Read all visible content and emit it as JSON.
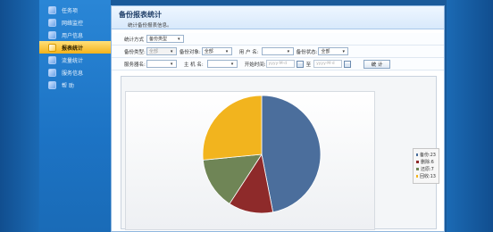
{
  "sidebar": {
    "items": [
      {
        "label": "任务项",
        "icon": "task-icon",
        "active": false
      },
      {
        "label": "网络监控",
        "icon": "network-monitor-icon",
        "active": false
      },
      {
        "label": "用户信息",
        "icon": "user-info-icon",
        "active": false
      },
      {
        "label": "报表统计",
        "icon": "report-icon",
        "active": true
      },
      {
        "label": "流量统计",
        "icon": "traffic-stats-icon",
        "active": false
      },
      {
        "label": "服务信息",
        "icon": "service-info-icon",
        "active": false
      },
      {
        "label": "帮 助",
        "icon": "help-icon",
        "active": false
      }
    ]
  },
  "header": {
    "title": "备份报表统计",
    "subtitle": "统计备份报表信息。"
  },
  "filters": {
    "stat_mode_label": "统计方式",
    "stat_mode_value": "备份类型",
    "backup_type_label": "备份类型:",
    "backup_type_value": "全部",
    "backup_target_label": "备份对象:",
    "backup_target_value": "全部",
    "user_label": "用 户 名:",
    "user_value": "",
    "status_label": "备份状态:",
    "status_value": "全部",
    "server_label": "服务器名:",
    "server_value": "",
    "host_label": "主 机 名:",
    "host_value": "",
    "start_time_label": "开始时间:",
    "date_placeholder": "yyyy-M-d",
    "to_label": "至",
    "stats_button": "统 计"
  },
  "colors": {
    "accent": "#f5b21a",
    "sidebar": "#1c73c4",
    "title_text": "#1d3c66"
  },
  "chart_data": {
    "type": "pie",
    "title": "",
    "legend_position": "right",
    "categories": [
      "备份",
      "删除",
      "还原",
      "回收"
    ],
    "values": [
      23,
      6,
      7,
      13
    ],
    "legend_labels": [
      "备份:23",
      "删除:6",
      "还原:7",
      "回收:13"
    ],
    "colors": [
      "#4b6e9c",
      "#8e2a2a",
      "#6f8556",
      "#f2b41e"
    ]
  }
}
